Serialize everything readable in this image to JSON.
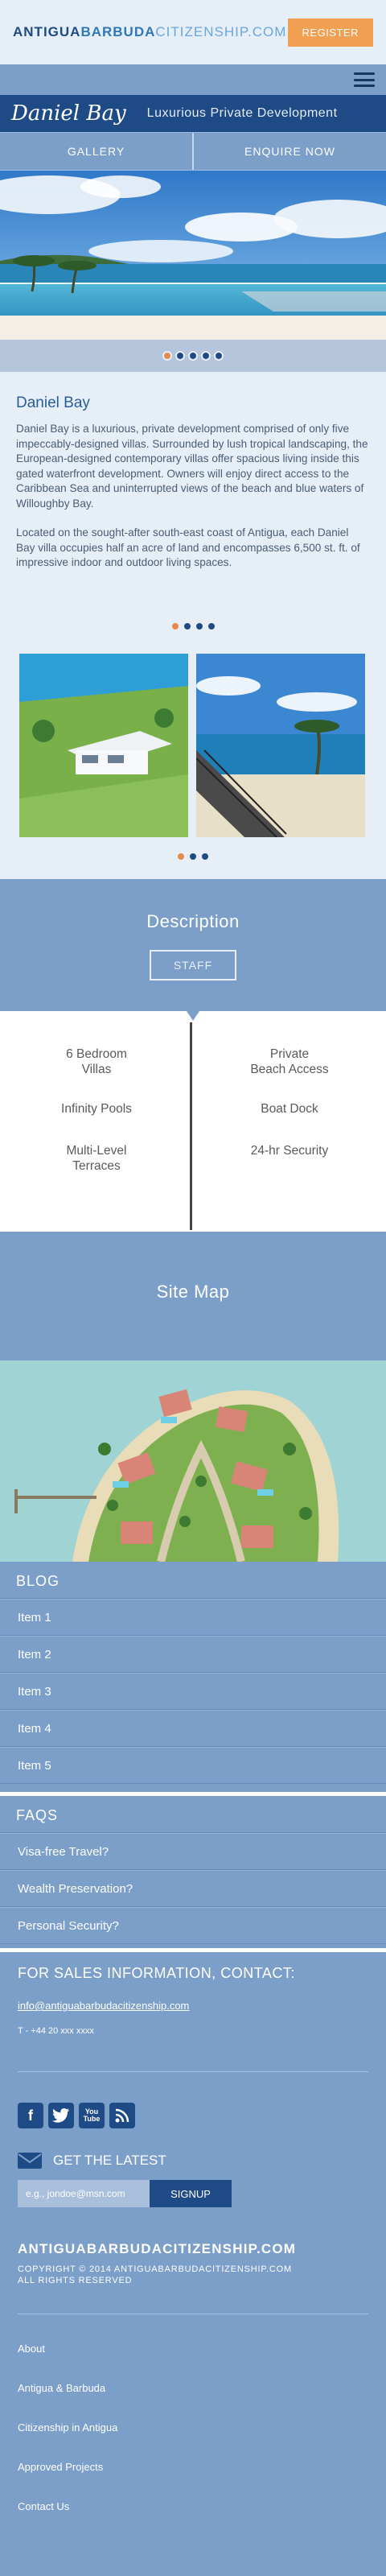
{
  "header": {
    "logo_part1": "ANTIGUA",
    "logo_part2": "BARBUDA",
    "logo_part3": "CITIZENSHIP.COM",
    "register_label": "REGISTER"
  },
  "title_bar": {
    "name": "Daniel Bay",
    "subtitle": "Luxurious Private Development"
  },
  "tabs": [
    "GALLERY",
    "ENQUIRE NOW"
  ],
  "intro": {
    "heading": "Daniel Bay",
    "para1": "Daniel Bay is a luxurious, private development comprised of only five impeccably-designed villas. Surrounded by lush tropical landscaping, the European-designed contemporary villas offer spacious living inside this gated waterfront development. Owners will enjoy direct access to the Caribbean Sea and uninterrupted views of the beach and blue waters of Willoughby Bay.",
    "para2": "Located on the sought-after south-east coast of Antigua, each Daniel Bay villa occupies half an acre of land and encompasses 6,500 st. ft. of impressive indoor and outdoor living spaces."
  },
  "description": {
    "heading": "Description",
    "staff_label": "STAFF"
  },
  "features": {
    "left": [
      "6 Bedroom\nVillas",
      "Infinity Pools",
      "Multi-Level\nTerraces"
    ],
    "right": [
      "Private\nBeach Access",
      "Boat Dock",
      "24-hr Security"
    ]
  },
  "sitemap": {
    "heading": "Site Map"
  },
  "blog": {
    "heading": "BLOG",
    "items": [
      "Item 1",
      "Item 2",
      "Item 3",
      "Item 4",
      "Item 5"
    ]
  },
  "faqs": {
    "heading": "FAQS",
    "items": [
      "Visa-free Travel?",
      "Wealth Preservation?",
      "Personal Security?"
    ]
  },
  "contact": {
    "heading": "FOR SALES INFORMATION, CONTACT:",
    "email": "info@antiguabarbudacitizenship.com",
    "phone": "T - +44 20 xxx xxxx",
    "latest_label": "GET THE LATEST",
    "input_placeholder": "e.g., jondoe@msn.com",
    "signup_label": "SIGNUP",
    "site_name": "ANTIGUABARBUDACITIZENSHIP.COM",
    "copyright": "COPYRIGHT © 2014 ANTIGUABARBUDACITIZENSHIP.COM\nALL RIGHTS RESERVED"
  },
  "social_icons": [
    "facebook-icon",
    "twitter-icon",
    "youtube-icon",
    "rss-icon"
  ],
  "social_youtube_text": "You\nTube",
  "footer_links": [
    "About",
    "Antigua & Barbuda",
    "Citizenship in Antigua",
    "Approved Projects",
    "Contact Us"
  ],
  "colors": {
    "navy": "#1e4a85",
    "steel_blue": "#7c9fc9",
    "orange": "#f0a050",
    "light_bg": "#e6eef8"
  }
}
